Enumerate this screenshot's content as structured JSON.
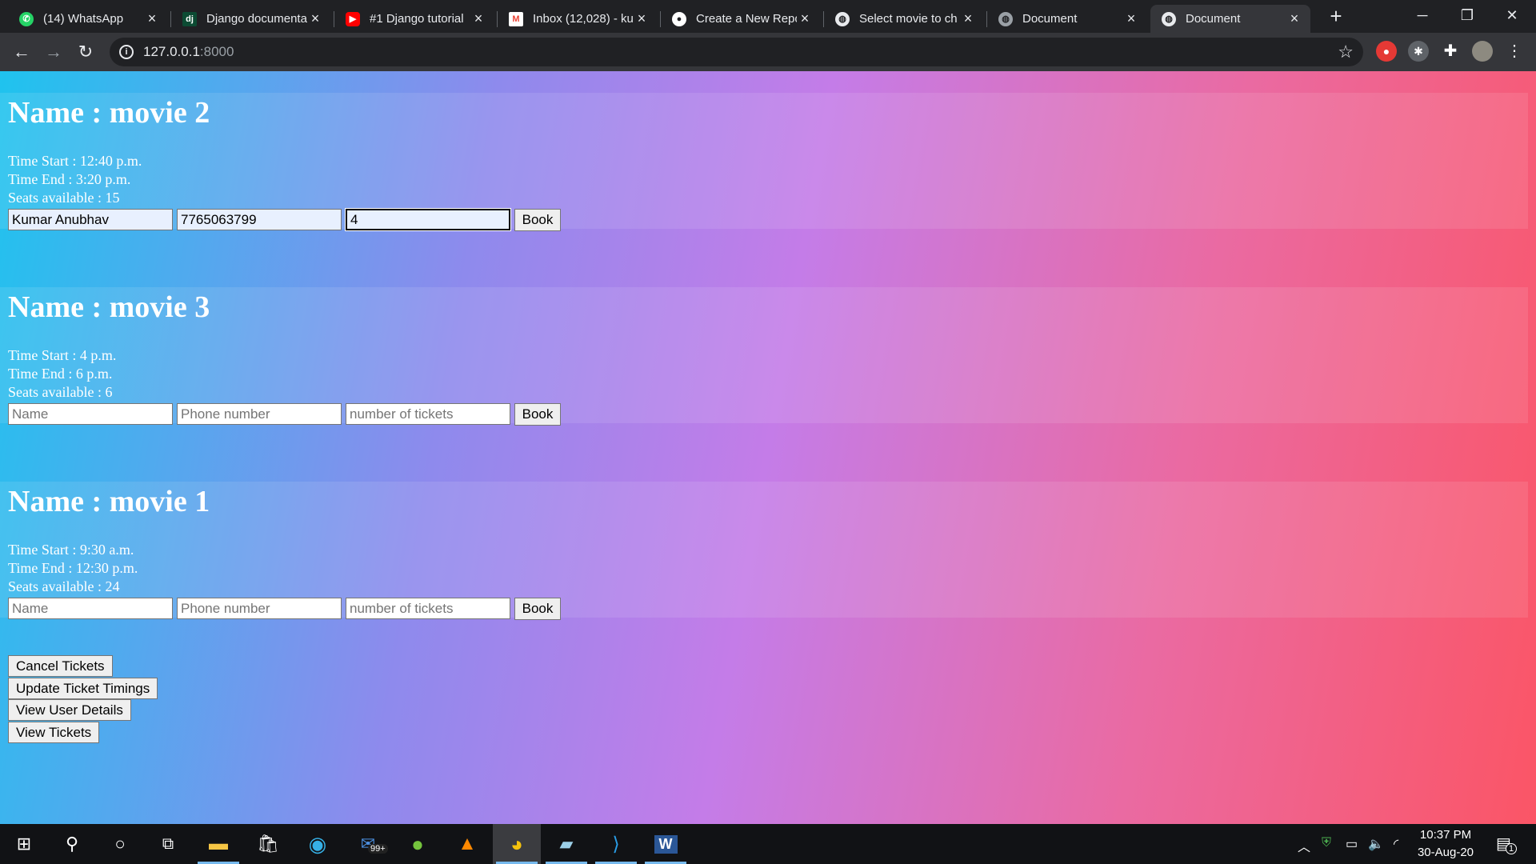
{
  "browser": {
    "tabs": [
      {
        "title": "(14) WhatsApp",
        "favicon": "whatsapp-icon",
        "favicon_color": "#25d366"
      },
      {
        "title": "Django documenta",
        "favicon": "django-icon",
        "favicon_color": "#0c4b33"
      },
      {
        "title": "#1 Django tutorial",
        "favicon": "youtube-icon",
        "favicon_color": "#ff0000"
      },
      {
        "title": "Inbox (12,028) - ku",
        "favicon": "gmail-icon",
        "favicon_color": "#ea4335"
      },
      {
        "title": "Create a New Repo",
        "favicon": "github-icon",
        "favicon_color": "#ffffff"
      },
      {
        "title": "Select movie to ch",
        "favicon": "globe-icon",
        "favicon_color": "#e8eaed"
      },
      {
        "title": "Document",
        "favicon": "globe-icon",
        "favicon_color": "#9aa0a6"
      },
      {
        "title": "Document",
        "favicon": "globe-icon",
        "favicon_color": "#e8eaed",
        "active": true
      }
    ],
    "url_host": "127.0.0.1",
    "url_port": ":8000"
  },
  "movies": [
    {
      "name_label": "Name : movie 2",
      "time_start": "Time Start : 12:40 p.m.",
      "time_end": "Time End : 3:20 p.m.",
      "seats": "Seats available : 15",
      "name_value": "Kumar Anubhav",
      "phone_value": "7765063799",
      "tickets_value": "4"
    },
    {
      "name_label": "Name : movie 3",
      "time_start": "Time Start : 4 p.m.",
      "time_end": "Time End : 6 p.m.",
      "seats": "Seats available : 6",
      "name_value": "",
      "phone_value": "",
      "tickets_value": ""
    },
    {
      "name_label": "Name : movie 1",
      "time_start": "Time Start : 9:30 a.m.",
      "time_end": "Time End : 12:30 p.m.",
      "seats": "Seats available : 24",
      "name_value": "",
      "phone_value": "",
      "tickets_value": ""
    }
  ],
  "form": {
    "name_placeholder": "Name",
    "phone_placeholder": "Phone number",
    "tickets_placeholder": "number of tickets",
    "book_label": "Book"
  },
  "actions": {
    "cancel": "Cancel Tickets",
    "update": "Update Ticket Timings",
    "user_details": "View User Details",
    "view_tickets": "View Tickets"
  },
  "taskbar": {
    "mail_badge": "99+",
    "time": "10:37 PM",
    "date": "30-Aug-20",
    "notification_count": "1"
  }
}
